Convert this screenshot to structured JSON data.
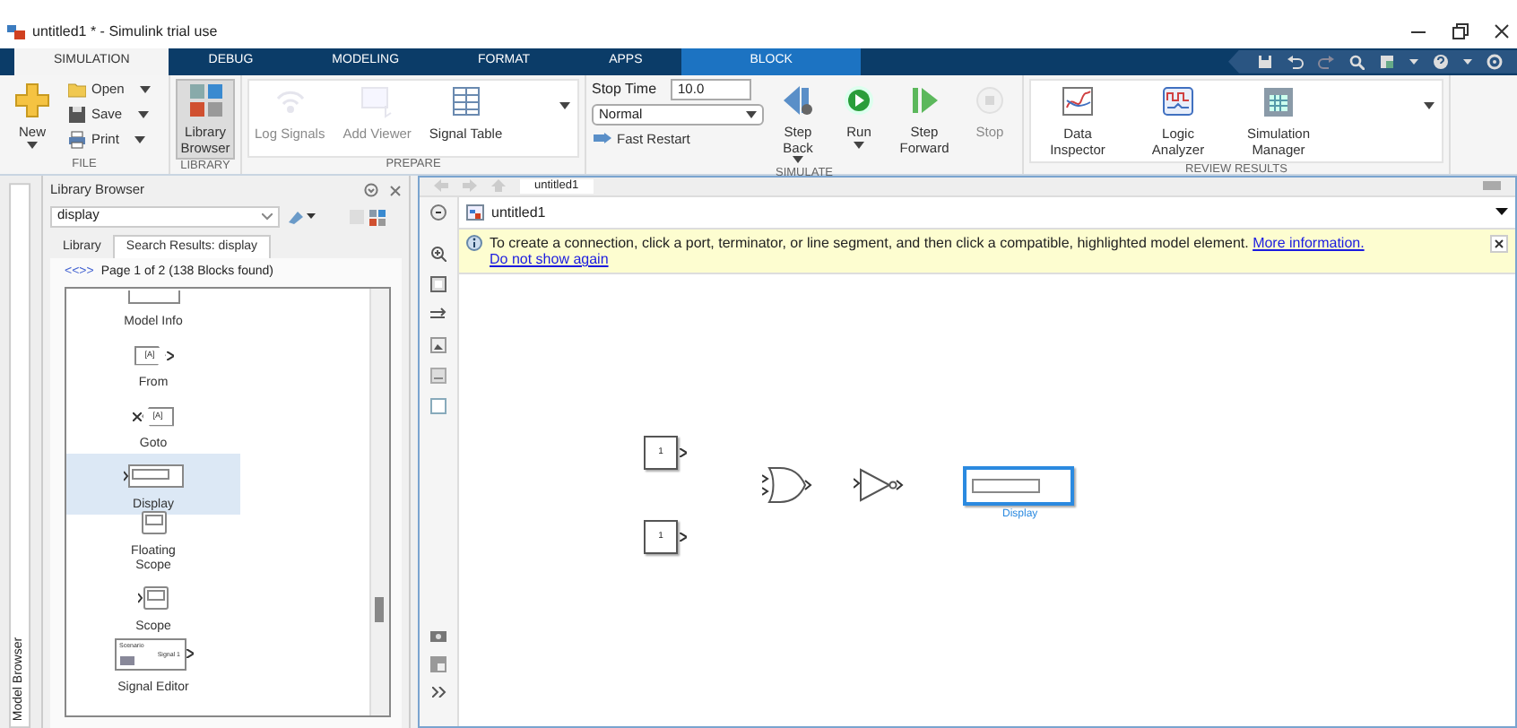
{
  "window": {
    "title": "untitled1 * - Simulink trial use"
  },
  "tabs": [
    {
      "label": "SIMULATION",
      "selected": true,
      "contextual": false
    },
    {
      "label": "DEBUG",
      "selected": false,
      "contextual": false
    },
    {
      "label": "MODELING",
      "selected": false,
      "contextual": false
    },
    {
      "label": "FORMAT",
      "selected": false,
      "contextual": false
    },
    {
      "label": "APPS",
      "selected": false,
      "contextual": false
    },
    {
      "label": "BLOCK",
      "selected": false,
      "contextual": true
    }
  ],
  "ribbon": [
    {
      "title": "FILE",
      "items": [
        {
          "kind": "large",
          "label": "New",
          "dropdown": true,
          "disabled": false
        },
        {
          "kind": "small",
          "label": "Open",
          "dropdown": true,
          "disabled": false
        },
        {
          "kind": "small",
          "label": "Save",
          "dropdown": true,
          "disabled": false
        },
        {
          "kind": "small",
          "label": "Print",
          "dropdown": true,
          "disabled": false
        }
      ]
    },
    {
      "title": "LIBRARY",
      "items": [
        {
          "kind": "large",
          "label": "Library Browser",
          "disabled": false,
          "on": true
        }
      ]
    },
    {
      "title": "PREPARE",
      "gallery": true,
      "items": [
        {
          "kind": "large",
          "label": "Log Signals",
          "disabled": true
        },
        {
          "kind": "large",
          "label": "Add Viewer",
          "disabled": true
        },
        {
          "kind": "large",
          "label": "Signal Table",
          "disabled": false
        }
      ]
    },
    {
      "title": "SIMULATE",
      "items": [
        {
          "kind": "stoptime",
          "label": "Stop Time",
          "value": "10.0"
        },
        {
          "kind": "select",
          "value": "Normal"
        },
        {
          "kind": "small",
          "label": "Fast Restart",
          "disabled": false
        },
        {
          "kind": "large",
          "label": "Step Back",
          "dropdown": true,
          "disabled": false
        },
        {
          "kind": "large",
          "label": "Run",
          "dropdown": true,
          "disabled": false
        },
        {
          "kind": "large",
          "label": "Step Forward",
          "disabled": false
        },
        {
          "kind": "large",
          "label": "Stop",
          "disabled": true
        }
      ]
    },
    {
      "title": "REVIEW RESULTS",
      "gallery": true,
      "items": [
        {
          "kind": "large",
          "label": "Data Inspector",
          "disabled": false
        },
        {
          "kind": "large",
          "label": "Logic Analyzer",
          "disabled": false
        },
        {
          "kind": "large",
          "label": "Simulation Manager",
          "disabled": false
        }
      ]
    }
  ],
  "side_tab": "Model Browser",
  "library": {
    "title": "Library Browser",
    "search": "display",
    "tabs": [
      {
        "label": "Library",
        "selected": false
      },
      {
        "label": "Search Results: display",
        "selected": true
      }
    ],
    "pager": "<<>>",
    "page": "Page 1 of 2 (138 Blocks found)",
    "blocks": [
      {
        "kind": "info",
        "label": "Model Info",
        "selected": false
      },
      {
        "kind": "from",
        "label": "From",
        "tag": "[A]",
        "selected": false
      },
      {
        "kind": "goto",
        "label": "Goto",
        "tag": "[A]",
        "selected": false
      },
      {
        "kind": "display",
        "label": "Display",
        "selected": true
      },
      {
        "kind": "floating_scope",
        "label": "Floating Scope",
        "selected": false
      },
      {
        "kind": "scope",
        "label": "Scope",
        "selected": false
      },
      {
        "kind": "signal_editor",
        "label": "Signal Editor",
        "tag": "Scenario",
        "tag2": "Signal 1",
        "selected": false
      }
    ]
  },
  "editor": {
    "tab": "untitled1",
    "path": "untitled1",
    "banner": {
      "message": "To create a connection, click a port, terminator, or line segment, and then click a compatible, highlighted model element.",
      "link": "More information.",
      "dismiss": "Do not show again"
    },
    "blocks": [
      {
        "kind": "constant",
        "value": "1",
        "selected": false
      },
      {
        "kind": "constant",
        "value": "1",
        "selected": false
      },
      {
        "kind": "or",
        "selected": false
      },
      {
        "kind": "not",
        "selected": false
      },
      {
        "kind": "display",
        "label": "Display",
        "selected": true
      }
    ]
  }
}
